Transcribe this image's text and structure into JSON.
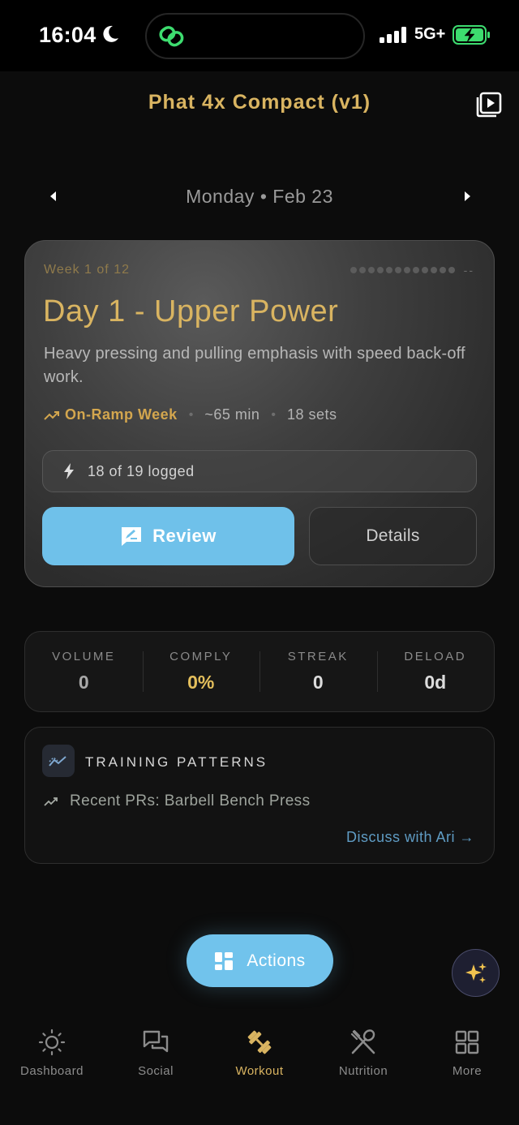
{
  "status_bar": {
    "time": "16:04",
    "network": "5G+",
    "icons": [
      "moon-icon",
      "link-icon",
      "signal-icon",
      "battery-charging-icon"
    ]
  },
  "header": {
    "title": "Phat 4x Compact (v1)",
    "action_icon": "video-library-icon"
  },
  "date_nav": {
    "label": "Monday • Feb 23"
  },
  "workout_card": {
    "week": "Week 1 of 12",
    "progress_dots_total": 12,
    "progress_dots_done": 0,
    "progress_suffix": "--",
    "title": "Day 1 - Upper Power",
    "description": "Heavy pressing and pulling emphasis with speed back-off work.",
    "phase": "On-Ramp Week",
    "sep": "•",
    "duration": "~65 min",
    "sets": "18 sets",
    "logged": "18 of 19 logged",
    "review_label": "Review",
    "details_label": "Details"
  },
  "stats": [
    {
      "label": "VOLUME",
      "value": "0"
    },
    {
      "label": "COMPLY",
      "value": "0%"
    },
    {
      "label": "STREAK",
      "value": "0"
    },
    {
      "label": "DELOAD",
      "value": "0d"
    }
  ],
  "patterns": {
    "title": "TRAINING PATTERNS",
    "pr_text": "Recent PRs: Barbell Bench Press",
    "discuss": "Discuss with Ari →"
  },
  "actions_label": "Actions",
  "tabs": [
    {
      "label": "Dashboard",
      "icon": "sun-icon"
    },
    {
      "label": "Social",
      "icon": "chat-icon"
    },
    {
      "label": "Workout",
      "icon": "dumbbell-icon",
      "active": true
    },
    {
      "label": "Nutrition",
      "icon": "utensils-icon"
    },
    {
      "label": "More",
      "icon": "grid-icon"
    }
  ],
  "colors": {
    "accent_gold": "#d9b461",
    "accent_blue": "#6fc1ea",
    "background": "#0c0c0c"
  }
}
